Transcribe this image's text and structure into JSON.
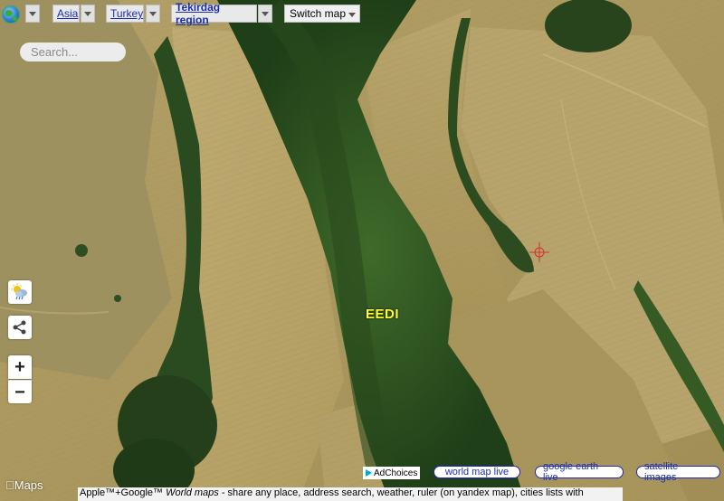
{
  "toolbar": {
    "globe_icon": "globe-icon",
    "continent": "Asia",
    "country": "Turkey",
    "region": "Tekirdag region",
    "switch_map": "Switch map"
  },
  "search": {
    "placeholder": "Search..."
  },
  "controls": {
    "weather_icon": "weather-icon",
    "share_icon": "share-icon",
    "zoom_in": "+",
    "zoom_out": "−"
  },
  "map": {
    "place_label": "EEDI",
    "provider_logo": "Maps"
  },
  "bottom": {
    "adchoices": "AdChoices",
    "world_map_live": "world map live",
    "google_earth_live": "google earth live",
    "satellite_images": "satellite images"
  },
  "footer": {
    "brand": "Apple™+Google™",
    "title": "World maps",
    "text": " - share any place, address search, weather, ruler (on yandex map), cities lists with"
  },
  "colors": {
    "place_label": "#ffff33",
    "link": "#1a2fb0",
    "crosshair": "#d23030"
  }
}
